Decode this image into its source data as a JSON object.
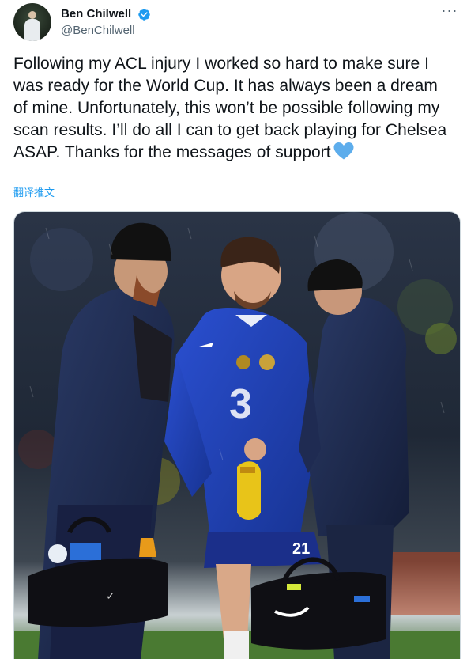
{
  "author": {
    "display_name": "Ben Chilwell",
    "handle": "@BenChilwell",
    "verified": true,
    "avatar_icon": "profile-avatar"
  },
  "menu": {
    "icon": "more-horizontal-icon",
    "glyph": "···"
  },
  "tweet": {
    "text": "Following my ACL injury I worked so hard to make sure I was ready for the World Cup. It has always been a dream of mine. Unfortunately, this won’t be possible following my scan results. I’ll do all I can to get back playing for Chelsea ASAP. Thanks for the messages of support",
    "emoji": "blue-heart-icon",
    "translate_label": "翻译推文"
  },
  "media": {
    "type": "photo",
    "shirt_number": "21"
  },
  "colors": {
    "link": "#1d9bf0",
    "verified": "#1d9bf0",
    "heart": "#5dadec",
    "secondary_text": "#536471"
  }
}
